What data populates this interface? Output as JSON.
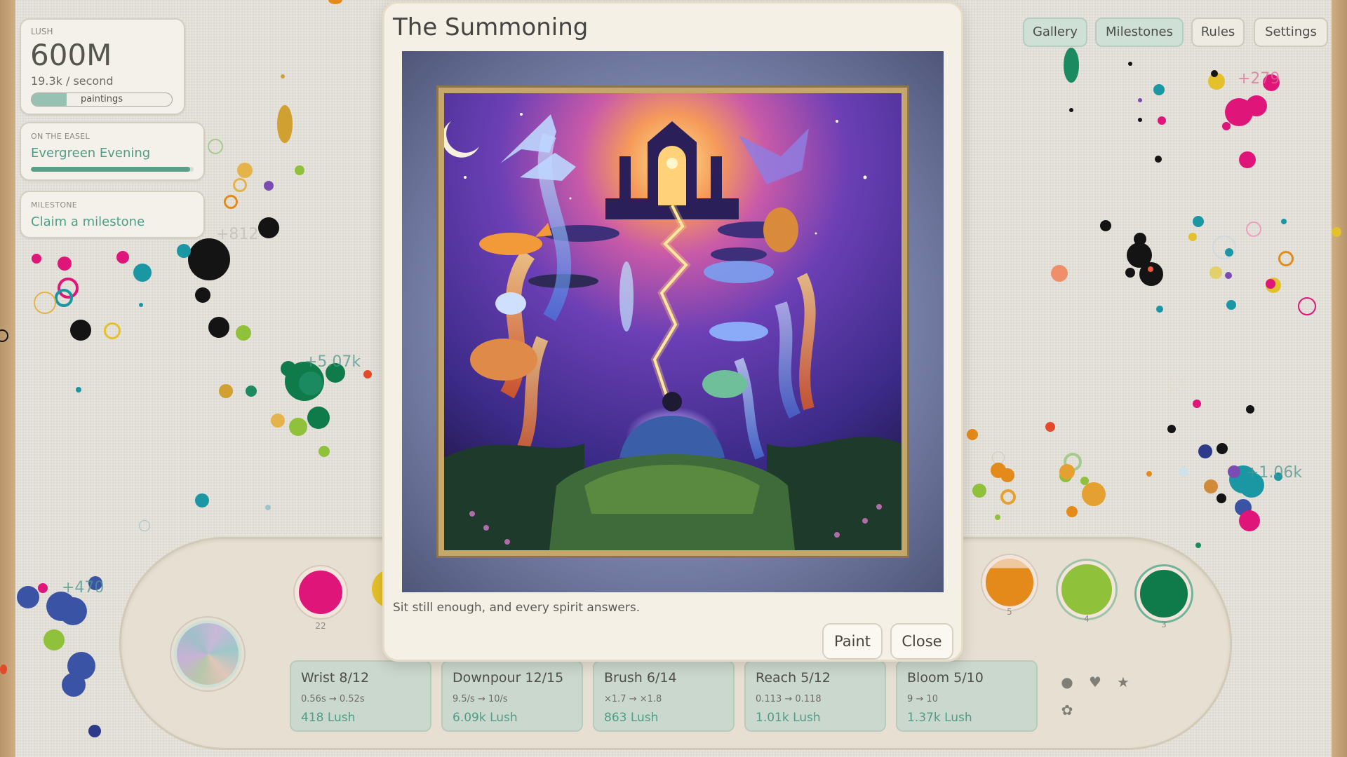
{
  "stats": {
    "currency_label": "LUSH",
    "amount": "600M",
    "rate": "19.3k / second",
    "paintings_label": "paintings",
    "paintings_progress": 0.25
  },
  "easel": {
    "label": "ON THE EASEL",
    "painting_name": "Evergreen Evening",
    "progress": 0.98
  },
  "milestone": {
    "label": "MILESTONE",
    "action": "Claim a milestone"
  },
  "nav": {
    "gallery": "Gallery",
    "milestones": "Milestones",
    "rules": "Rules",
    "settings": "Settings"
  },
  "floaters": [
    "+812",
    "+5.07k",
    "+279",
    "+1.06k",
    "+470"
  ],
  "modal": {
    "title": "The Summoning",
    "caption": "Sit still enough, and every spirit answers.",
    "paint_label": "Paint",
    "close_label": "Close"
  },
  "palette": [
    {
      "color": "#e0157a",
      "count": "22"
    },
    {
      "color": "#e48a1a",
      "count": "5"
    },
    {
      "color": "#8fc13a",
      "count": "4"
    },
    {
      "color": "#0f7a4a",
      "count": "3"
    }
  ],
  "upgrades": [
    {
      "title": "Wrist 8/12",
      "change": "0.56s → 0.52s",
      "cost": "418 Lush"
    },
    {
      "title": "Downpour 12/15",
      "change": "9.5/s → 10/s",
      "cost": "6.09k Lush"
    },
    {
      "title": "Brush 6/14",
      "change": "×1.7 → ×1.8",
      "cost": "863 Lush"
    },
    {
      "title": "Reach 5/12",
      "change": "0.113 → 0.118",
      "cost": "1.01k Lush"
    },
    {
      "title": "Bloom 5/10",
      "change": "9 → 10",
      "cost": "1.37k Lush"
    }
  ],
  "colors": {
    "accent_teal": "#4f9c89",
    "panel_bg": "#f4f1ea",
    "modal_bg": "#f5f0e6",
    "upgrade_bg": "#cbd8cd"
  },
  "icons": [
    "circle-icon",
    "heart-icon",
    "star-icon",
    "flower-icon"
  ]
}
